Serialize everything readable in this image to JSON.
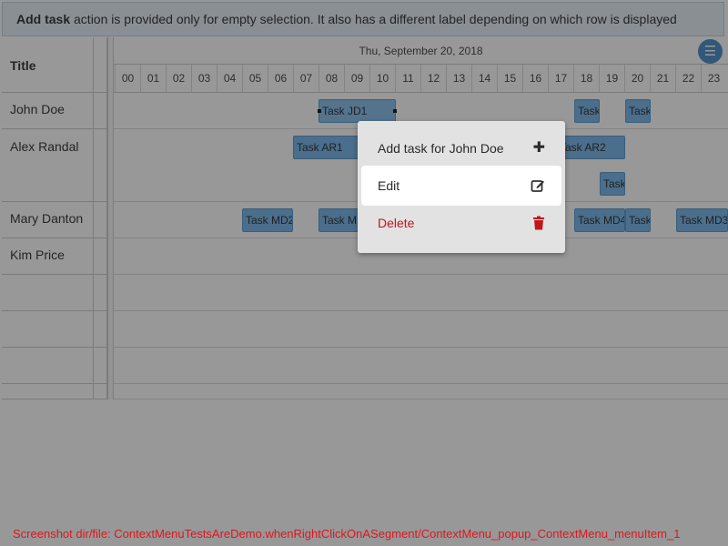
{
  "banner": {
    "bold": "Add task",
    "text": " action is provided only for empty selection. It also has a different label depending on which row is displayed"
  },
  "table": {
    "title_header": "Title",
    "rows": [
      "John Doe",
      "Alex Randal",
      "",
      "Mary Danton",
      "Kim Price",
      "",
      "",
      ""
    ]
  },
  "timeline": {
    "date": "Thu, September 20, 2018",
    "hours": [
      "00",
      "01",
      "02",
      "03",
      "04",
      "05",
      "06",
      "07",
      "08",
      "09",
      "10",
      "11",
      "12",
      "13",
      "14",
      "15",
      "16",
      "17",
      "18",
      "19",
      "20",
      "21",
      "22",
      "23"
    ],
    "menu_icon": "menu-icon"
  },
  "tasks": {
    "jd1": "Task JD1",
    "jd_a": "Task",
    "jd_b": "Task",
    "ar1": "Task AR1",
    "ar2": "Task AR2",
    "ar_c": "Task",
    "md2": "Task MD2",
    "md_b": "Task M",
    "md4": "Task MD4",
    "md_c": "Task",
    "md3": "Task MD3"
  },
  "context_menu": {
    "items": [
      {
        "label": "Add task for John Doe",
        "icon": "plus-icon"
      },
      {
        "label": "Edit",
        "icon": "edit-icon"
      },
      {
        "label": "Delete",
        "icon": "trash-icon",
        "color": "#c0171b"
      }
    ]
  },
  "footer_note": "Screenshot dir/file: ContextMenuTestsAreDemo.whenRightClickOnASegment/ContextMenu_popup_ContextMenu_menuItem_1"
}
